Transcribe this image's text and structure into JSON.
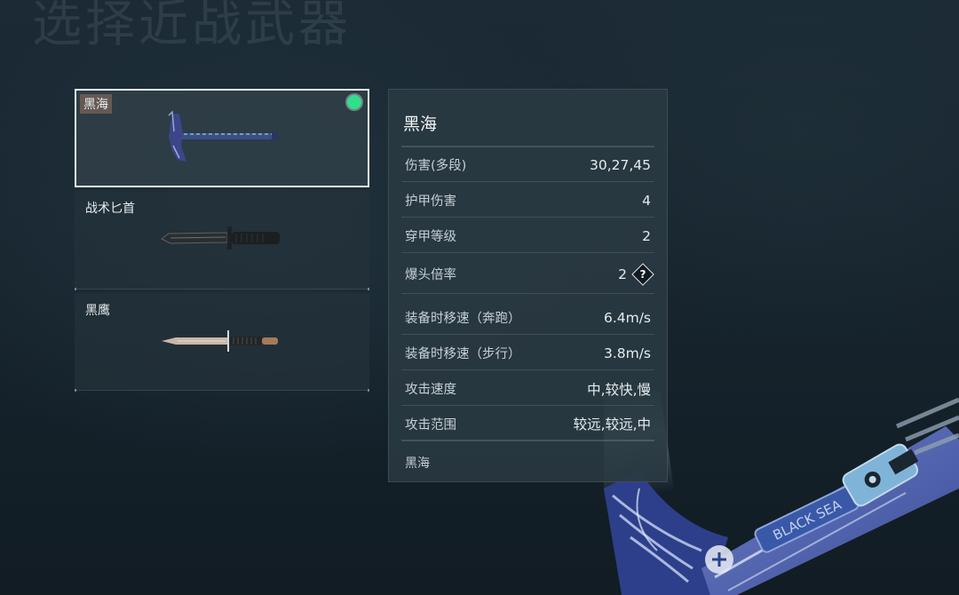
{
  "screen_title": "选择近战武器",
  "weapons": [
    {
      "name": "黑海",
      "selected": true,
      "equipped": true
    },
    {
      "name": "战术匕首",
      "selected": false,
      "equipped": false
    },
    {
      "name": "黑鹰",
      "selected": false,
      "equipped": false
    }
  ],
  "stats": {
    "title": "黑海",
    "rows": [
      {
        "label": "伤害(多段)",
        "value": "30,27,45"
      },
      {
        "label": "护甲伤害",
        "value": "4"
      },
      {
        "label": "穿甲等级",
        "value": "2"
      },
      {
        "label": "爆头倍率",
        "value": "2"
      },
      {
        "label": "装备时移速（奔跑）",
        "value": "6.4m/s"
      },
      {
        "label": "装备时移速（步行）",
        "value": "3.8m/s"
      },
      {
        "label": "攻击速度",
        "value": "中,较快,慢"
      },
      {
        "label": "攻击范围",
        "value": "较远,较远,中"
      }
    ],
    "help_glyph": "?",
    "footer": "黑海"
  },
  "preview_engraving": "BLACK SEA",
  "colors": {
    "equipped_indicator": "#2fe08a",
    "selected_border": "#e8eef0",
    "weapon_blue": "#4a5fb8"
  }
}
